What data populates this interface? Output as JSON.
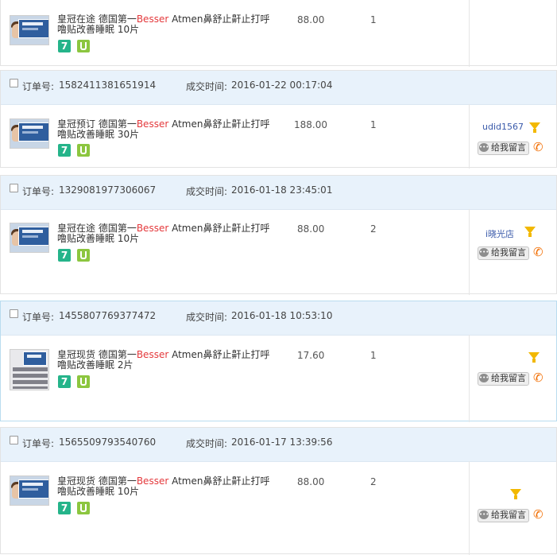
{
  "labels": {
    "order_no": "订单号:",
    "deal_time": "成交时间:",
    "message_button": "给我留言",
    "badge_seven": "7"
  },
  "top_partial": {
    "title_prefix": "皇冠在途 德国第一",
    "title_brand": "Besser",
    "title_suffix": " Atmen鼻舒止鼾止打呼噜贴改善睡眠 10片",
    "price": "88.00",
    "qty": "1"
  },
  "orders": [
    {
      "order_no": "1582411381651914",
      "time": "2016-01-22 00:17:04",
      "title_prefix": "皇冠预订 德国第一",
      "title_brand": "Besser",
      "title_suffix": " Atmen鼻舒止鼾止打呼噜贴改善睡眠 30片",
      "price": "188.00",
      "qty": "1",
      "buyer": "udid1567"
    },
    {
      "order_no": "1329081977306067",
      "time": "2016-01-18 23:45:01",
      "title_prefix": "皇冠在途 德国第一",
      "title_brand": "Besser",
      "title_suffix": " Atmen鼻舒止鼾止打呼噜贴改善睡眠 10片",
      "price": "88.00",
      "qty": "2",
      "buyer": "i晓光店"
    },
    {
      "order_no": "1455807769377472",
      "time": "2016-01-18 10:53:10",
      "title_prefix": "皇冠现货 德国第一",
      "title_brand": "Besser",
      "title_suffix": " Atmen鼻舒止鼾止打呼噜贴改善睡眠 2片",
      "price": "17.60",
      "qty": "1",
      "buyer": ""
    },
    {
      "order_no": "1565509793540760",
      "time": "2016-01-17 13:39:56",
      "title_prefix": "皇冠现货 德国第一",
      "title_brand": "Besser",
      "title_suffix": " Atmen鼻舒止鼾止打呼噜贴改善睡眠 10片",
      "price": "88.00",
      "qty": "2",
      "buyer": ""
    }
  ],
  "colors": {
    "header_bg": "#e8f2fb",
    "brand_red": "#e4393c",
    "badge_green": "#25b48a",
    "badge_lime": "#8cc63f",
    "phone_orange": "#f26d00",
    "funnel_yellow": "#f2b800"
  },
  "icons": [
    "checkbox",
    "product-thumbnail",
    "seven-day-return-icon",
    "guarantee-icon",
    "filter-funnel-icon",
    "message-icon",
    "phone-icon"
  ]
}
